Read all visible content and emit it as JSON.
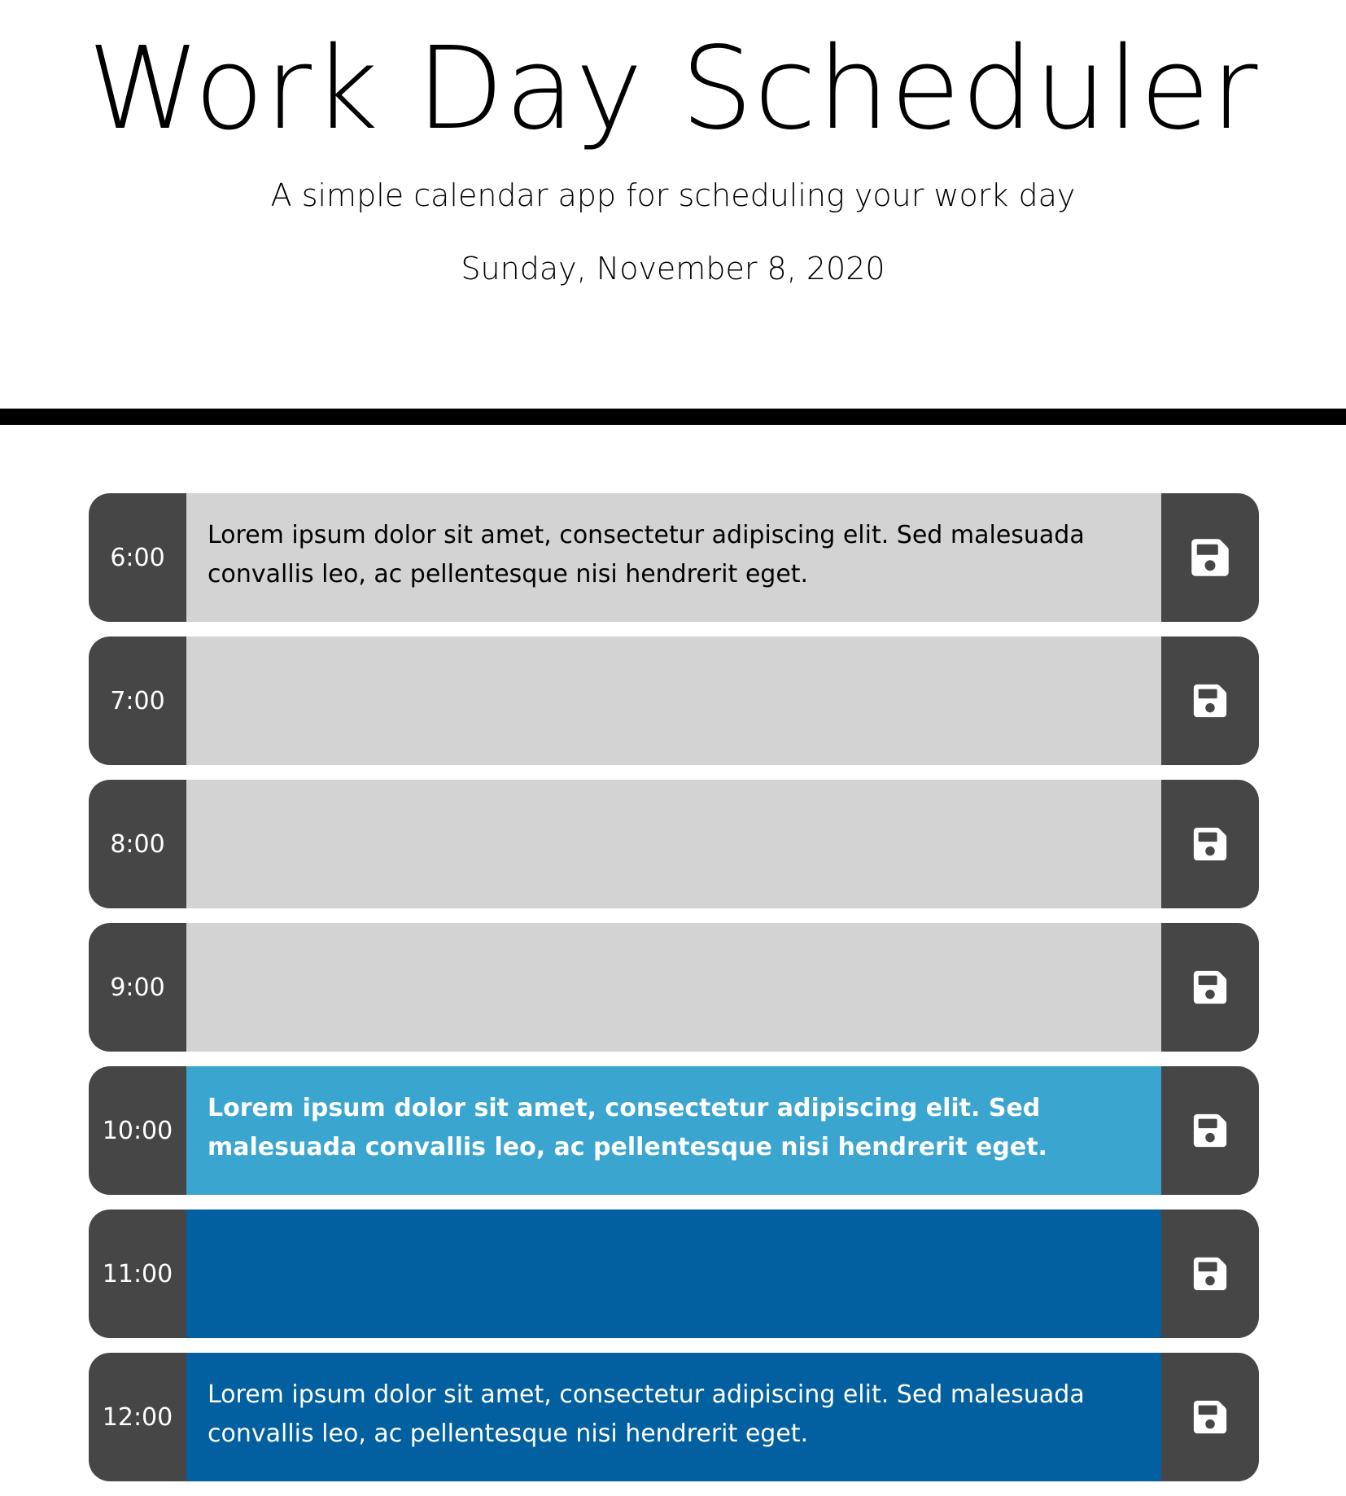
{
  "header": {
    "title": "Work Day Scheduler",
    "lead": "A simple calendar app for scheduling your work day",
    "current_day": "Sunday, November 8, 2020"
  },
  "colors": {
    "past": "#d3d3d3",
    "present": "#3aa6d0",
    "future": "#0360a0",
    "hour_block": "#464646",
    "save_button": "#464646"
  },
  "save_icon": "floppy-disk-icon",
  "rows": [
    {
      "hour": "6:00",
      "text": "Lorem ipsum dolor sit amet, consectetur adipiscing elit. Sed malesuada convallis leo, ac pellentesque nisi hendrerit eget.",
      "state": "past"
    },
    {
      "hour": "7:00",
      "text": "",
      "state": "past"
    },
    {
      "hour": "8:00",
      "text": "",
      "state": "past"
    },
    {
      "hour": "9:00",
      "text": "",
      "state": "past"
    },
    {
      "hour": "10:00",
      "text": "Lorem ipsum dolor sit amet, consectetur adipiscing elit. Sed malesuada convallis leo, ac pellentesque nisi hendrerit eget.",
      "state": "present"
    },
    {
      "hour": "11:00",
      "text": "",
      "state": "future"
    },
    {
      "hour": "12:00",
      "text": "Lorem ipsum dolor sit amet, consectetur adipiscing elit. Sed malesuada convallis leo, ac pellentesque nisi hendrerit eget.",
      "state": "future"
    }
  ]
}
